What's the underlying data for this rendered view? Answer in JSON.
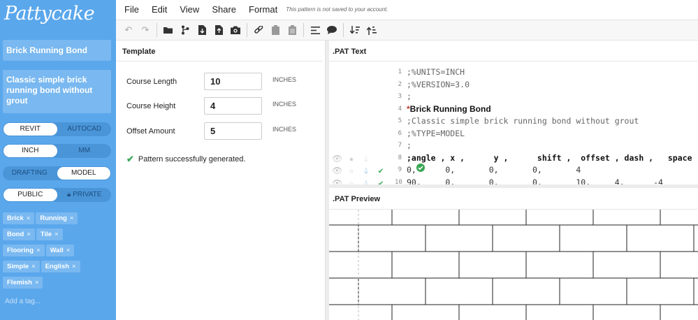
{
  "app": {
    "logo": "Pattycake"
  },
  "sidebar": {
    "pattern_name": "Brick Running Bond",
    "pattern_description": "Classic simple brick running bond without grout",
    "toggles": [
      {
        "name": "software",
        "options": [
          "REVIT",
          "AUTOCAD"
        ],
        "selected": 0
      },
      {
        "name": "units",
        "options": [
          "INCH",
          "MM"
        ],
        "selected": 0
      },
      {
        "name": "type",
        "options": [
          "DRAFTING",
          "MODEL"
        ],
        "selected": 1
      },
      {
        "name": "visibility",
        "options": [
          "PUBLIC",
          "PRIVATE"
        ],
        "selected": 0
      }
    ],
    "tags": [
      "Brick",
      "Running",
      "Bond",
      "Tile",
      "Flooring",
      "Wall",
      "Simple",
      "English",
      "Flemish"
    ],
    "add_tag_placeholder": "Add a tag..."
  },
  "menubar": {
    "items": [
      "File",
      "Edit",
      "View",
      "Share",
      "Format"
    ],
    "save_note": "This pattern is not saved to your account."
  },
  "toolbar": {
    "icons": [
      "undo-icon",
      "redo-icon",
      "open-folder-icon",
      "branch-icon",
      "import-icon",
      "export-icon",
      "camera-icon",
      "link-icon",
      "copy-icon",
      "paste-icon",
      "align-icon",
      "comment-icon",
      "sort-down-icon",
      "sort-up-icon"
    ]
  },
  "template": {
    "title": "Template",
    "fields": [
      {
        "label": "Course Length",
        "value": "10",
        "unit": "INCHES"
      },
      {
        "label": "Course Height",
        "value": "4",
        "unit": "INCHES"
      },
      {
        "label": "Offset Amount",
        "value": "5",
        "unit": "INCHES"
      }
    ],
    "status": "Pattern successfully generated."
  },
  "pat_text": {
    "title": ".PAT Text",
    "lines": [
      {
        "n": "1",
        "text": ";%UNITS=INCH"
      },
      {
        "n": "2",
        "text": ";%VERSION=3.0"
      },
      {
        "n": "3",
        "text": ";"
      },
      {
        "n": "4",
        "text": "Brick Running Bond",
        "prefix": "*"
      },
      {
        "n": "5",
        "text": ";Classic simple brick running bond without grout"
      },
      {
        "n": "6",
        "text": ";%TYPE=MODEL"
      },
      {
        "n": "7",
        "text": ";"
      },
      {
        "n": "8",
        "text": ";angle , x ,      y ,      shift ,  offset , dash ,   space"
      },
      {
        "n": "9",
        "text": "0,      0,       0,       0,       4"
      },
      {
        "n": "10",
        "text": "90,     0,       0,       0,       10,     4,      -4"
      }
    ]
  },
  "pat_preview": {
    "title": ".PAT Preview"
  }
}
